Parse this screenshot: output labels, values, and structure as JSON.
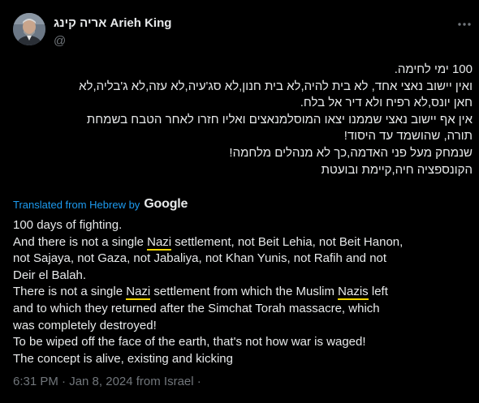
{
  "author": {
    "name": "אריה קינג Arieh King",
    "handle": "@"
  },
  "tweet": {
    "hebrew_lines": [
      "100 ימי לחימה.",
      "ואין יישוב נאצי אחד, לא בית להיה,לא בית חנון,לא סג'עיה,לא עזה,לא ג'בליה,לא",
      "חאן יונס,לא רפיח ולא דיר אל בלח.",
      "אין אף יישוב נאצי שממנו יצאו המוסלמנאצים ואליו חזרו לאחר הטבח בשמחת",
      "תורה, שהושמד עד היסוד!",
      "שנמחק מעל פני האדמה,כך לא מנהלים מלחמה!",
      "הקונספציה חיה,קיימת ובועטת"
    ],
    "translated_label": "Translated from Hebrew by",
    "translator": "Google",
    "english": {
      "line1": "100 days of fighting.",
      "line2_a": "And there is not a single ",
      "line2_nazi": "Nazi",
      "line2_b": " settlement, not Beit Lehia, not Beit Hanon,",
      "line3": "not Sajaya, not Gaza, not Jabaliya, not Khan Yunis, not Rafih and not",
      "line4": "Deir el Balah.",
      "line5_a": "There is not a single ",
      "line5_nazi": "Nazi",
      "line5_b": " settlement from which the Muslim ",
      "line5_nazis": "Nazis",
      "line5_c": " left",
      "line6": "and to which they returned after the Simchat Torah massacre, which",
      "line7": "was completely destroyed!",
      "line8": "To be wiped off the face of the earth, that's not how war is waged!",
      "line9": "The concept is alive, existing and kicking"
    },
    "timestamp": "6:31 PM · Jan 8, 2024 from Israel ·"
  },
  "colors": {
    "background": "#000000",
    "text": "#e7e9ea",
    "secondary": "#71767b",
    "link": "#1d9bf0",
    "highlight": "#f2d600"
  },
  "icons": {
    "more": "more-horizontal-icon"
  }
}
